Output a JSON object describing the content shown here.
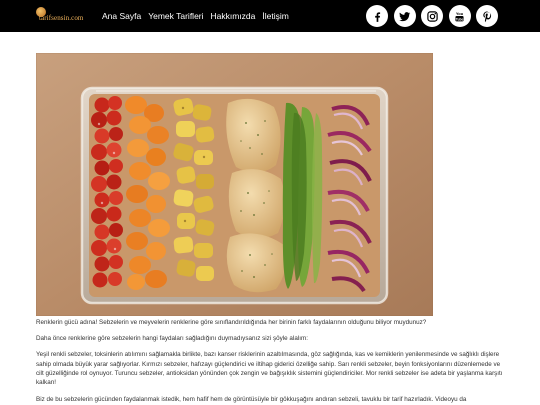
{
  "site": {
    "logo_text": "tarifsensin.com"
  },
  "nav": {
    "items": [
      {
        "label": "Ana Sayfa"
      },
      {
        "label": "Yemek Tarifleri"
      },
      {
        "label": "Hakkımızda"
      },
      {
        "label": "İletişim"
      }
    ]
  },
  "social": {
    "icons": [
      "facebook-icon",
      "twitter-icon",
      "instagram-icon",
      "youtube-icon",
      "pinterest-icon"
    ]
  },
  "colors": {
    "topbar": "#000000",
    "logo": "#f0b35c",
    "background": "#ffffff",
    "text": "#333333"
  },
  "article": {
    "paragraphs": [
      "Renklerin gücü adına! Sebzelerin ve meyvelerin renklerine göre sınıflandırıldığında her birinin farklı faydalarının olduğunu biliyor muydunuz?",
      "Daha önce renklerine göre sebzelerin hangi faydaları sağladığını duymadıysanız sizi şöyle alalım:",
      "Yeşil renkli sebzeler, toksinlerin atılımını sağlamakla birlikte, bazı kanser risklerinin azaltılmasında, göz sağlığında, kas ve kemiklerin yenilenmesinde ve sağlıklı dişlere sahip olmada büyük yarar sağlıyorlar. Kırmızı sebzeler, hafızayı güçlendirici ve iltihap giderici özelliğe sahip. Sarı renkli sebzeler, beyin fonksiyonlarını düzenlemede ve cilt güzelliğinde rol oynuyor. Turuncu sebzeler, antioksidan yönünden çok zengin ve bağışıklık sistemini güçlendiriciler. Mor renkli sebzeler ise adeta bir yaşlanma karşıtı kalkan!",
      "Biz de bu sebzelerin gücünden faydalanmak istedik, hem hafif hem de görüntüsüyle bir gökkuşağını andıran sebzeli, tavuklu bir tarif hazırladık. Videoyu da"
    ]
  }
}
